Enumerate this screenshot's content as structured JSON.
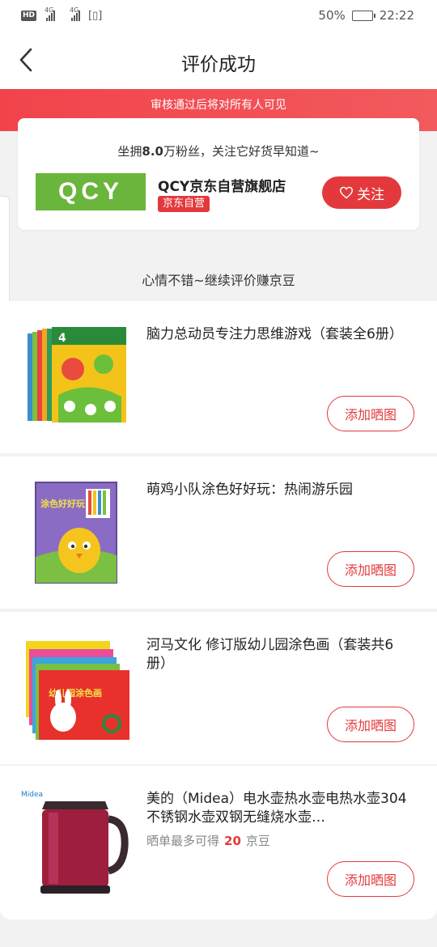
{
  "status_bar": {
    "hd": "HD",
    "signal1_tag": "4G",
    "signal2_tag": "4G",
    "battery_percent": "50%",
    "battery_level": 0.5,
    "time": "22:22"
  },
  "nav": {
    "title": "评价成功"
  },
  "banner": {
    "text": "审核通过后将对所有人可见"
  },
  "store": {
    "hint_prefix": "坐拥",
    "hint_count": "8.0",
    "hint_suffix": "万粉丝，关注它好货早知道~",
    "logo_text": "QCY",
    "name": "QCY京东自营旗舰店",
    "tag": "京东自营",
    "follow_label": "关注"
  },
  "section": {
    "title": "心情不错~继续评价赚京豆"
  },
  "products": [
    {
      "title": "脑力总动员专注力思维游戏（套装全6册）",
      "button": "添加晒图"
    },
    {
      "title": "萌鸡小队涂色好好玩：热闹游乐园",
      "button": "添加晒图"
    },
    {
      "title": "河马文化 修订版幼儿园涂色画（套装共6册）",
      "button": "添加晒图"
    },
    {
      "title": "美的（Midea）电水壶热水壶电热水壶304不锈钢水壶双钢无缝烧水壶…",
      "reward_prefix": "晒单最多可得",
      "reward_num": "20",
      "reward_suffix": "京豆",
      "button": "添加晒图"
    }
  ],
  "product_images": {
    "book2_cover": "涂色好好玩",
    "book3_cover": "幼儿园涂色画",
    "kettle_brand": "Midea"
  },
  "colors": {
    "accent": "#e4393c",
    "logo_green": "#6ab53b"
  }
}
